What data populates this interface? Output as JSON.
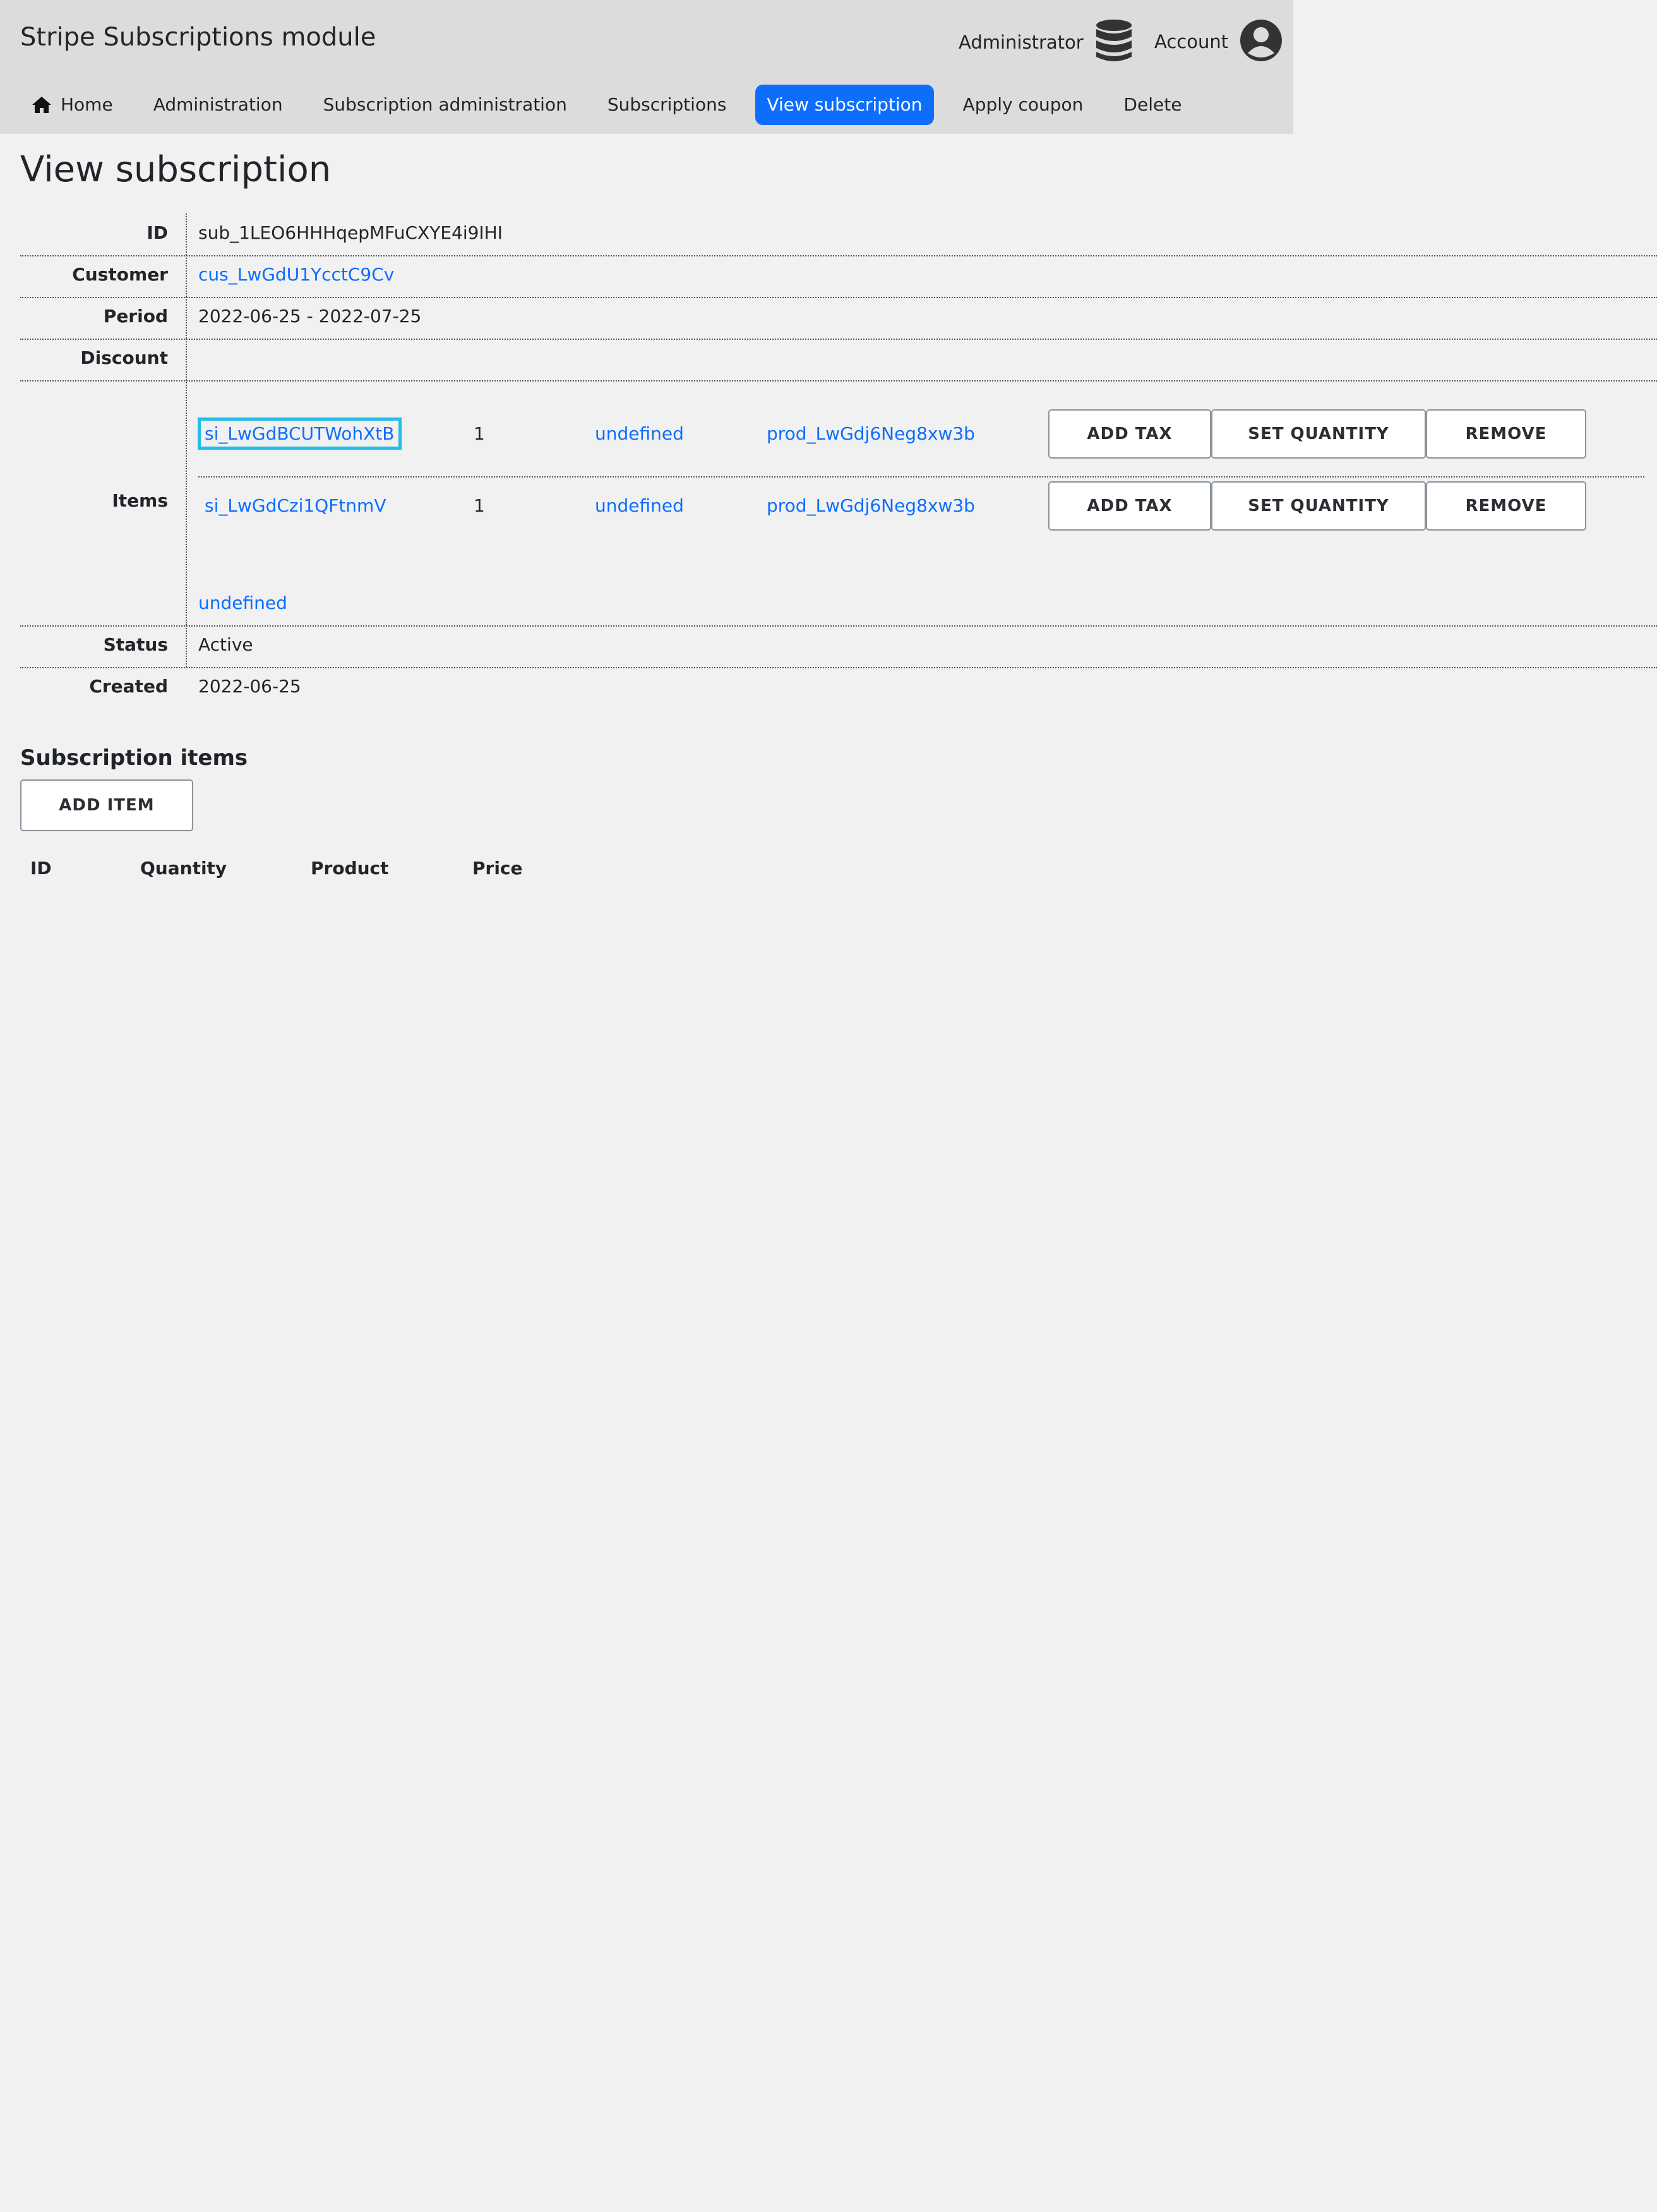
{
  "header": {
    "app_title": "Stripe Subscriptions module",
    "admin_label": "Administrator",
    "admin_icon": "database-icon",
    "account_label": "Account",
    "account_icon": "user-circle-icon"
  },
  "nav": {
    "items": [
      {
        "label": "Home",
        "icon": "home-icon"
      },
      {
        "label": "Administration"
      },
      {
        "label": "Subscription administration"
      },
      {
        "label": "Subscriptions"
      },
      {
        "label": "View subscription",
        "active": true
      },
      {
        "label": "Apply coupon"
      },
      {
        "label": "Delete"
      }
    ]
  },
  "page": {
    "title": "View subscription"
  },
  "details": {
    "id_label": "ID",
    "id_value": "sub_1LEO6HHHqepMFuCXYE4i9IHI",
    "customer_label": "Customer",
    "customer_value": "cus_LwGdU1YcctC9Cv",
    "period_label": "Period",
    "period_value": "2022-06-25 - 2022-07-25",
    "discount_label": "Discount",
    "discount_value": "",
    "items_label": "Items",
    "items": [
      {
        "id": "si_LwGdBCUTWohXtB",
        "quantity": "1",
        "price": "undefined",
        "product": "prod_LwGdj6Neg8xw3b"
      },
      {
        "id": "si_LwGdCzi1QFtnmV",
        "quantity": "1",
        "price": "undefined",
        "product": "prod_LwGdj6Neg8xw3b"
      }
    ],
    "items_more_link": "undefined",
    "status_label": "Status",
    "status_value": "Active",
    "created_label": "Created",
    "created_value": "2022-06-25"
  },
  "item_actions": {
    "add_tax": "ADD TAX",
    "set_quantity": "SET QUANTITY",
    "remove": "REMOVE"
  },
  "subscription_items": {
    "title": "Subscription items",
    "add_item_label": "ADD ITEM",
    "columns": [
      "ID",
      "Quantity",
      "Product",
      "Price"
    ]
  },
  "colors": {
    "accent": "#0d6efd",
    "focus": "#22bde6",
    "header_bg": "#dcdcdc",
    "page_bg": "#f1f1f1"
  }
}
